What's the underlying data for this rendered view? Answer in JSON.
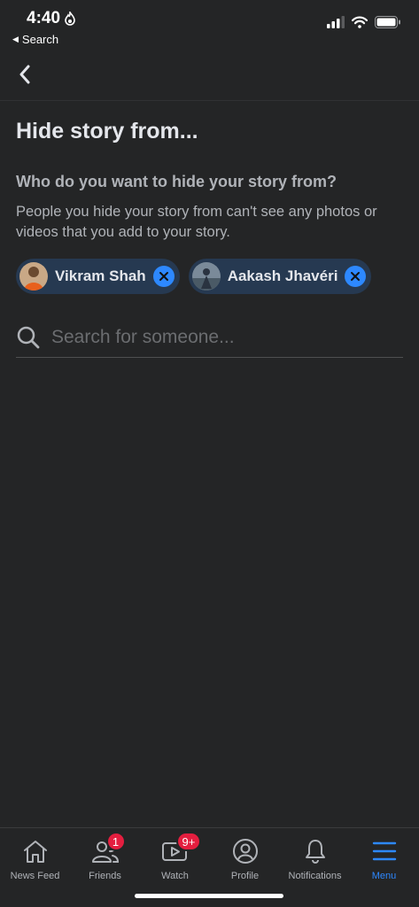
{
  "status_bar": {
    "time": "4:40",
    "back_label": "Search"
  },
  "page": {
    "title": "Hide story from...",
    "question": "Who do you want to hide your story from?",
    "description": "People you hide your story from can't see any photos or videos that you add to your story."
  },
  "selected_people": [
    {
      "name": "Vikram Shah"
    },
    {
      "name": "Aakash Jhavéri"
    }
  ],
  "search": {
    "placeholder": "Search for someone...",
    "value": ""
  },
  "tabs": [
    {
      "label": "News Feed",
      "icon": "home-icon"
    },
    {
      "label": "Friends",
      "icon": "friends-icon",
      "badge": "1"
    },
    {
      "label": "Watch",
      "icon": "watch-icon",
      "badge": "9+"
    },
    {
      "label": "Profile",
      "icon": "profile-icon"
    },
    {
      "label": "Notifications",
      "icon": "bell-icon"
    },
    {
      "label": "Menu",
      "icon": "menu-icon",
      "active": true
    }
  ],
  "colors": {
    "background": "#242526",
    "accent": "#2d88ff",
    "chip_bg": "#263951",
    "badge": "#e41e3f"
  }
}
